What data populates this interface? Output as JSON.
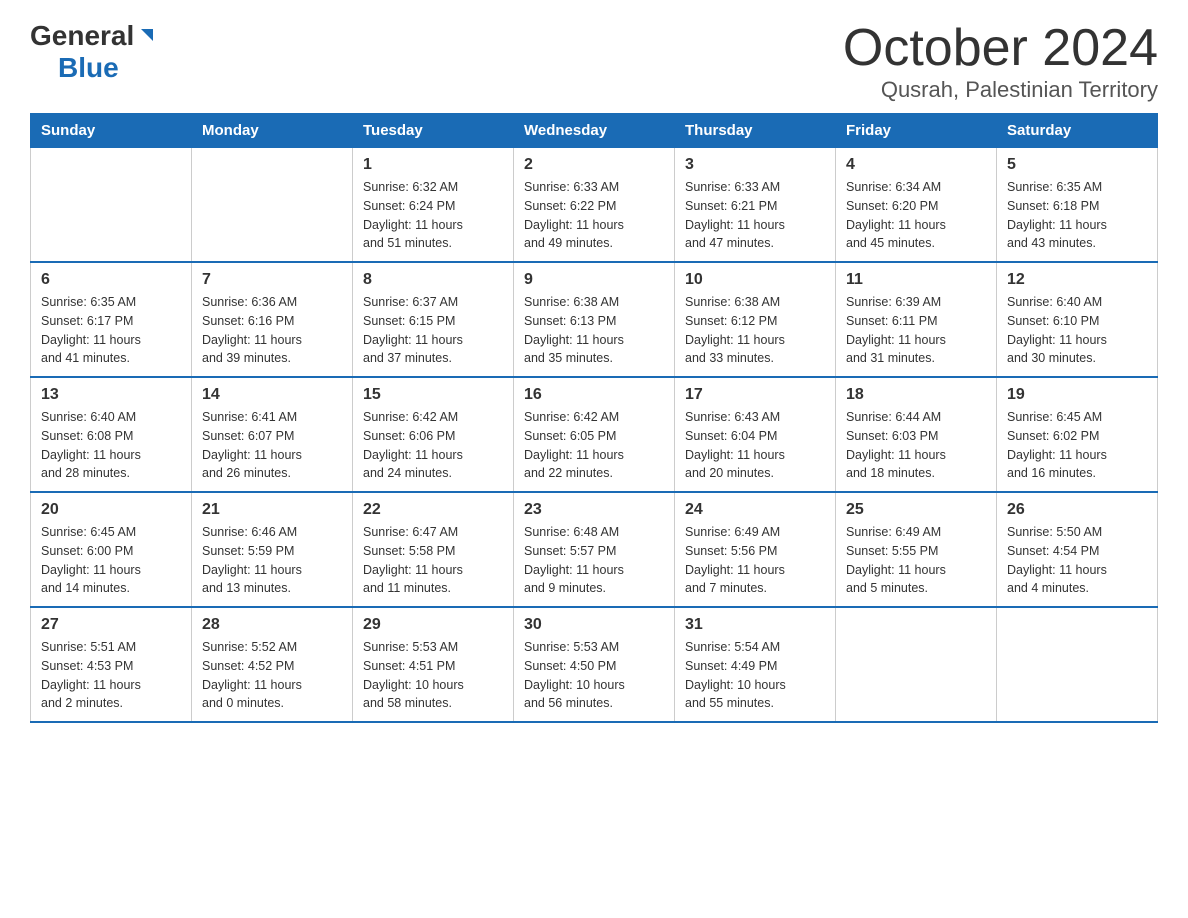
{
  "logo": {
    "general": "General",
    "blue": "Blue"
  },
  "title": "October 2024",
  "subtitle": "Qusrah, Palestinian Territory",
  "days_of_week": [
    "Sunday",
    "Monday",
    "Tuesday",
    "Wednesday",
    "Thursday",
    "Friday",
    "Saturday"
  ],
  "weeks": [
    [
      {
        "day": "",
        "info": ""
      },
      {
        "day": "",
        "info": ""
      },
      {
        "day": "1",
        "info": "Sunrise: 6:32 AM\nSunset: 6:24 PM\nDaylight: 11 hours\nand 51 minutes."
      },
      {
        "day": "2",
        "info": "Sunrise: 6:33 AM\nSunset: 6:22 PM\nDaylight: 11 hours\nand 49 minutes."
      },
      {
        "day": "3",
        "info": "Sunrise: 6:33 AM\nSunset: 6:21 PM\nDaylight: 11 hours\nand 47 minutes."
      },
      {
        "day": "4",
        "info": "Sunrise: 6:34 AM\nSunset: 6:20 PM\nDaylight: 11 hours\nand 45 minutes."
      },
      {
        "day": "5",
        "info": "Sunrise: 6:35 AM\nSunset: 6:18 PM\nDaylight: 11 hours\nand 43 minutes."
      }
    ],
    [
      {
        "day": "6",
        "info": "Sunrise: 6:35 AM\nSunset: 6:17 PM\nDaylight: 11 hours\nand 41 minutes."
      },
      {
        "day": "7",
        "info": "Sunrise: 6:36 AM\nSunset: 6:16 PM\nDaylight: 11 hours\nand 39 minutes."
      },
      {
        "day": "8",
        "info": "Sunrise: 6:37 AM\nSunset: 6:15 PM\nDaylight: 11 hours\nand 37 minutes."
      },
      {
        "day": "9",
        "info": "Sunrise: 6:38 AM\nSunset: 6:13 PM\nDaylight: 11 hours\nand 35 minutes."
      },
      {
        "day": "10",
        "info": "Sunrise: 6:38 AM\nSunset: 6:12 PM\nDaylight: 11 hours\nand 33 minutes."
      },
      {
        "day": "11",
        "info": "Sunrise: 6:39 AM\nSunset: 6:11 PM\nDaylight: 11 hours\nand 31 minutes."
      },
      {
        "day": "12",
        "info": "Sunrise: 6:40 AM\nSunset: 6:10 PM\nDaylight: 11 hours\nand 30 minutes."
      }
    ],
    [
      {
        "day": "13",
        "info": "Sunrise: 6:40 AM\nSunset: 6:08 PM\nDaylight: 11 hours\nand 28 minutes."
      },
      {
        "day": "14",
        "info": "Sunrise: 6:41 AM\nSunset: 6:07 PM\nDaylight: 11 hours\nand 26 minutes."
      },
      {
        "day": "15",
        "info": "Sunrise: 6:42 AM\nSunset: 6:06 PM\nDaylight: 11 hours\nand 24 minutes."
      },
      {
        "day": "16",
        "info": "Sunrise: 6:42 AM\nSunset: 6:05 PM\nDaylight: 11 hours\nand 22 minutes."
      },
      {
        "day": "17",
        "info": "Sunrise: 6:43 AM\nSunset: 6:04 PM\nDaylight: 11 hours\nand 20 minutes."
      },
      {
        "day": "18",
        "info": "Sunrise: 6:44 AM\nSunset: 6:03 PM\nDaylight: 11 hours\nand 18 minutes."
      },
      {
        "day": "19",
        "info": "Sunrise: 6:45 AM\nSunset: 6:02 PM\nDaylight: 11 hours\nand 16 minutes."
      }
    ],
    [
      {
        "day": "20",
        "info": "Sunrise: 6:45 AM\nSunset: 6:00 PM\nDaylight: 11 hours\nand 14 minutes."
      },
      {
        "day": "21",
        "info": "Sunrise: 6:46 AM\nSunset: 5:59 PM\nDaylight: 11 hours\nand 13 minutes."
      },
      {
        "day": "22",
        "info": "Sunrise: 6:47 AM\nSunset: 5:58 PM\nDaylight: 11 hours\nand 11 minutes."
      },
      {
        "day": "23",
        "info": "Sunrise: 6:48 AM\nSunset: 5:57 PM\nDaylight: 11 hours\nand 9 minutes."
      },
      {
        "day": "24",
        "info": "Sunrise: 6:49 AM\nSunset: 5:56 PM\nDaylight: 11 hours\nand 7 minutes."
      },
      {
        "day": "25",
        "info": "Sunrise: 6:49 AM\nSunset: 5:55 PM\nDaylight: 11 hours\nand 5 minutes."
      },
      {
        "day": "26",
        "info": "Sunrise: 5:50 AM\nSunset: 4:54 PM\nDaylight: 11 hours\nand 4 minutes."
      }
    ],
    [
      {
        "day": "27",
        "info": "Sunrise: 5:51 AM\nSunset: 4:53 PM\nDaylight: 11 hours\nand 2 minutes."
      },
      {
        "day": "28",
        "info": "Sunrise: 5:52 AM\nSunset: 4:52 PM\nDaylight: 11 hours\nand 0 minutes."
      },
      {
        "day": "29",
        "info": "Sunrise: 5:53 AM\nSunset: 4:51 PM\nDaylight: 10 hours\nand 58 minutes."
      },
      {
        "day": "30",
        "info": "Sunrise: 5:53 AM\nSunset: 4:50 PM\nDaylight: 10 hours\nand 56 minutes."
      },
      {
        "day": "31",
        "info": "Sunrise: 5:54 AM\nSunset: 4:49 PM\nDaylight: 10 hours\nand 55 minutes."
      },
      {
        "day": "",
        "info": ""
      },
      {
        "day": "",
        "info": ""
      }
    ]
  ]
}
